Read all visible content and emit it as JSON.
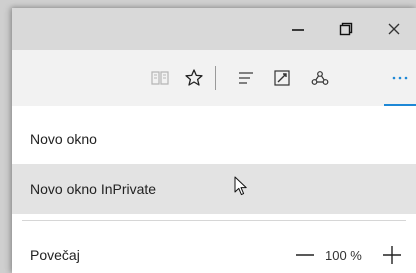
{
  "window": {
    "minimize_icon": "minimize-icon",
    "maximize_icon": "restore-icon",
    "close_icon": "close-icon"
  },
  "toolbar": {
    "reading_view_icon": "reading-view-icon",
    "favorites_icon": "star-icon",
    "hub_icon": "hub-icon",
    "web_note_icon": "web-note-icon",
    "share_icon": "share-icon",
    "more_icon": "more-icon"
  },
  "menu": {
    "new_window": "Novo okno",
    "new_inprivate_window": "Novo okno InPrivate",
    "zoom_label": "Povečaj",
    "zoom_value": "100 %"
  },
  "colors": {
    "accent": "#1e88d6",
    "hover": "#e3e3e3",
    "titlebar": "#d9d9d9",
    "toolbar": "#f2f2f2"
  }
}
